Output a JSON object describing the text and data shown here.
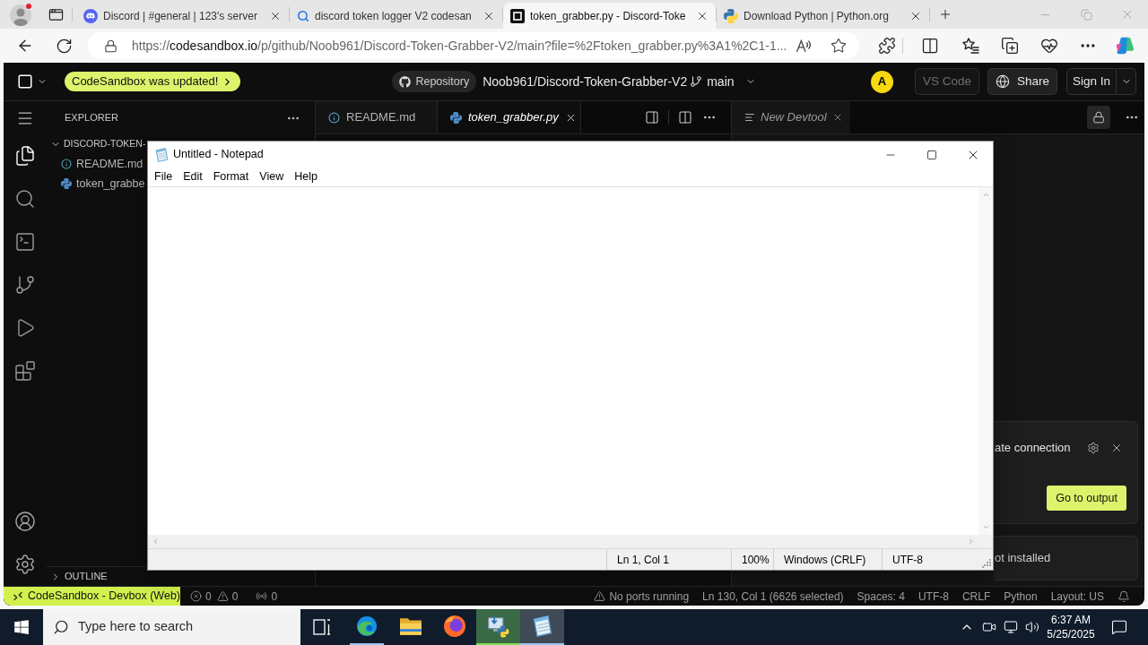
{
  "browser": {
    "tabs": [
      {
        "title": "Discord | #general | 123's server",
        "selected": false
      },
      {
        "title": "discord token logger V2 codesan",
        "selected": false
      },
      {
        "title": "token_grabber.py - Discord-Toke",
        "selected": true
      },
      {
        "title": "Download Python | Python.org",
        "selected": false
      }
    ],
    "address": {
      "scheme": "https://",
      "host": "codesandbox.io",
      "path": "/p/github/Noob961/Discord-Token-Grabber-V2/main?file=%2Ftoken_grabber.py%3A1%2C1-1..."
    }
  },
  "header": {
    "update_banner": "CodeSandbox was updated!",
    "repository_label": "Repository",
    "repo": "Noob961/Discord-Token-Grabber-V2",
    "branch": "main",
    "avatar": "A",
    "vscode_button": {
      "label": "VS Code",
      "disabled": true
    },
    "share_button": "Share",
    "sign_in_button": "Sign In"
  },
  "activity_bar": [
    {
      "selected": true
    },
    {
      "selected": false
    },
    {
      "selected": false
    },
    {
      "selected": false
    },
    {
      "selected": false
    },
    {
      "selected": false
    }
  ],
  "explorer": {
    "title": "EXPLORER",
    "folder": {
      "name": "DISCORD-TOKEN-",
      "expanded": true,
      "children": [
        {
          "name": "README.md"
        },
        {
          "name": "token_grabbe"
        }
      ]
    },
    "outline": {
      "title": "OUTLINE",
      "expanded": false
    }
  },
  "editor_tabs": [
    {
      "label": "README.md",
      "selected": false
    },
    {
      "label": "token_grabber.py",
      "selected": true
    }
  ],
  "devtool_tab": "New Devtool",
  "notifications": [
    {
      "message": "ate connection",
      "button": "Go to output"
    },
    {
      "message": "ot installed"
    }
  ],
  "status_bar": {
    "remote": "CodeSandbox - Devbox (Web)",
    "errors": "0",
    "warnings": "0",
    "ports": "0",
    "ports_status": "No ports running",
    "items": [
      "Ln 130, Col 1 (6626 selected)",
      "Spaces: 4",
      "UTF-8",
      "CRLF",
      "Python",
      "Layout: US"
    ]
  },
  "notepad": {
    "title": "Untitled - Notepad",
    "menu": [
      "File",
      "Edit",
      "Format",
      "View",
      "Help"
    ],
    "status": [
      "Ln 1, Col 1",
      "100%",
      "Windows (CRLF)",
      "UTF-8"
    ]
  },
  "taskbar": {
    "search_placeholder": "Type here to search",
    "apps": [
      {
        "running": true,
        "selected": false,
        "flashing": false
      },
      {
        "running": false,
        "selected": false,
        "flashing": false
      },
      {
        "running": false,
        "selected": false,
        "flashing": false
      },
      {
        "running": true,
        "selected": false,
        "flashing": true
      },
      {
        "running": true,
        "selected": true,
        "flashing": false
      }
    ],
    "time": "6:37 AM",
    "date": "5/25/2025"
  }
}
